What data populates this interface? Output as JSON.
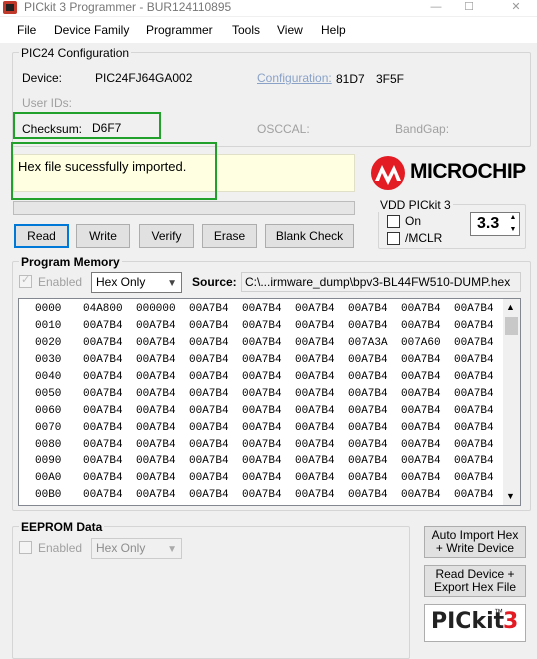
{
  "window": {
    "title": "PICkit 3 Programmer - BUR124110895",
    "min": "—",
    "max": "☐",
    "close": "✕"
  },
  "menu": [
    "File",
    "Device Family",
    "Programmer",
    "Tools",
    "View",
    "Help"
  ],
  "config_group": {
    "title": "PIC24 Configuration",
    "device_label": "Device:",
    "device_value": "PIC24FJ64GA002",
    "configuration_label": "Configuration:",
    "configuration_values": [
      "81D7",
      "3F5F"
    ],
    "user_ids_label": "User IDs:",
    "checksum_label": "Checksum:",
    "checksum_value": "D6F7",
    "osccal_label": "OSCCAL:",
    "bandgap_label": "BandGap:"
  },
  "status": {
    "message": "Hex file sucessfully imported."
  },
  "brand_logo": {
    "text": "MICROCHIP"
  },
  "vdd": {
    "title": "VDD PICkit 3",
    "on_label": "On",
    "mclr_label": "/MCLR",
    "voltage": "3.3"
  },
  "actions": {
    "read": "Read",
    "write": "Write",
    "verify": "Verify",
    "erase": "Erase",
    "blank_check": "Blank Check"
  },
  "program_memory": {
    "title": "Program Memory",
    "enabled_label": "Enabled",
    "mode": "Hex Only",
    "source_label": "Source:",
    "source_path": "C:\\...irmware_dump\\bpv3-BL44FW510-DUMP.hex",
    "rows": [
      {
        "addr": "0000",
        "cells": [
          "04A800",
          "000000",
          "00A7B4",
          "00A7B4",
          "00A7B4",
          "00A7B4",
          "00A7B4",
          "00A7B4"
        ]
      },
      {
        "addr": "0010",
        "cells": [
          "00A7B4",
          "00A7B4",
          "00A7B4",
          "00A7B4",
          "00A7B4",
          "00A7B4",
          "00A7B4",
          "00A7B4"
        ]
      },
      {
        "addr": "0020",
        "cells": [
          "00A7B4",
          "00A7B4",
          "00A7B4",
          "00A7B4",
          "00A7B4",
          "007A3A",
          "007A60",
          "00A7B4"
        ]
      },
      {
        "addr": "0030",
        "cells": [
          "00A7B4",
          "00A7B4",
          "00A7B4",
          "00A7B4",
          "00A7B4",
          "00A7B4",
          "00A7B4",
          "00A7B4"
        ]
      },
      {
        "addr": "0040",
        "cells": [
          "00A7B4",
          "00A7B4",
          "00A7B4",
          "00A7B4",
          "00A7B4",
          "00A7B4",
          "00A7B4",
          "00A7B4"
        ]
      },
      {
        "addr": "0050",
        "cells": [
          "00A7B4",
          "00A7B4",
          "00A7B4",
          "00A7B4",
          "00A7B4",
          "00A7B4",
          "00A7B4",
          "00A7B4"
        ]
      },
      {
        "addr": "0060",
        "cells": [
          "00A7B4",
          "00A7B4",
          "00A7B4",
          "00A7B4",
          "00A7B4",
          "00A7B4",
          "00A7B4",
          "00A7B4"
        ]
      },
      {
        "addr": "0070",
        "cells": [
          "00A7B4",
          "00A7B4",
          "00A7B4",
          "00A7B4",
          "00A7B4",
          "00A7B4",
          "00A7B4",
          "00A7B4"
        ]
      },
      {
        "addr": "0080",
        "cells": [
          "00A7B4",
          "00A7B4",
          "00A7B4",
          "00A7B4",
          "00A7B4",
          "00A7B4",
          "00A7B4",
          "00A7B4"
        ]
      },
      {
        "addr": "0090",
        "cells": [
          "00A7B4",
          "00A7B4",
          "00A7B4",
          "00A7B4",
          "00A7B4",
          "00A7B4",
          "00A7B4",
          "00A7B4"
        ]
      },
      {
        "addr": "00A0",
        "cells": [
          "00A7B4",
          "00A7B4",
          "00A7B4",
          "00A7B4",
          "00A7B4",
          "00A7B4",
          "00A7B4",
          "00A7B4"
        ]
      },
      {
        "addr": "00B0",
        "cells": [
          "00A7B4",
          "00A7B4",
          "00A7B4",
          "00A7B4",
          "00A7B4",
          "00A7B4",
          "00A7B4",
          "00A7B4"
        ]
      }
    ]
  },
  "eeprom": {
    "title": "EEPROM Data",
    "enabled_label": "Enabled",
    "mode": "Hex Only"
  },
  "side_buttons": {
    "auto_import": "Auto Import Hex\n+ Write Device",
    "read_export": "Read Device +\nExport Hex File"
  },
  "pickit_logo": {
    "text": "PICkit",
    "tm": "™",
    "num": "3"
  },
  "colors": {
    "highlight_green": "#22a02c",
    "status_bg": "#ffffe1",
    "link": "#8aa2c8",
    "microchip_red": "#e31b23"
  },
  "icons": {
    "app": "pickit-app-icon",
    "scroll_up": "chevron-up-icon",
    "scroll_down": "chevron-down-icon"
  }
}
